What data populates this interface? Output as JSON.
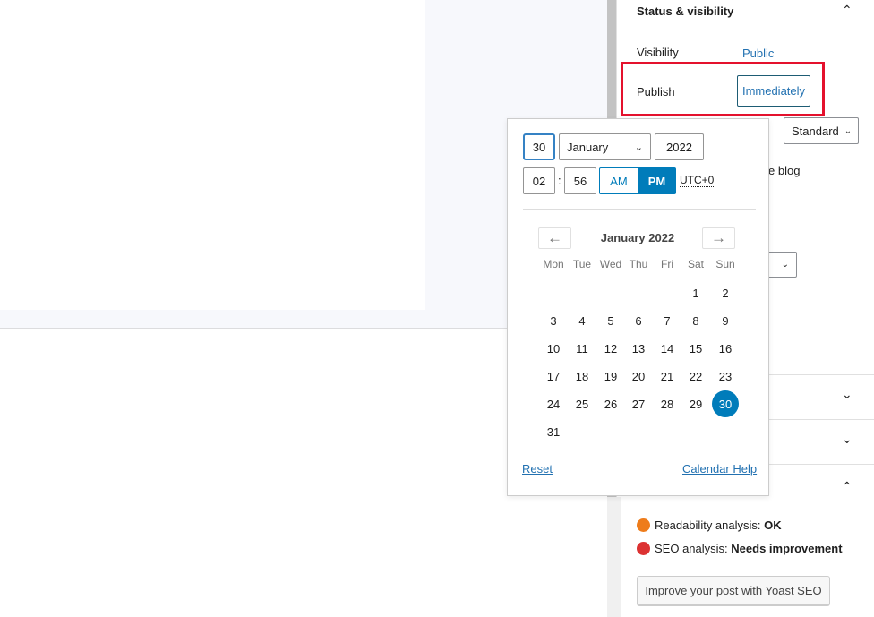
{
  "sidebar": {
    "panel_title": "Status & visibility",
    "visibility_label": "Visibility",
    "visibility_value": "Public",
    "publish_label": "Publish",
    "publish_value": "Immediately",
    "post_format_value": "Standard",
    "sticky_partial": "e blog",
    "yoast": {
      "readability_label": "Readability analysis:",
      "readability_value": "OK",
      "seo_label": "SEO analysis:",
      "seo_value": "Needs improvement",
      "button": "Improve your post with Yoast SEO",
      "readability_color": "#ee7c1b",
      "seo_color": "#dc3232"
    }
  },
  "datepicker": {
    "day": "30",
    "month": "January",
    "year": "2022",
    "hour": "02",
    "minute": "56",
    "am": "AM",
    "pm": "PM",
    "selected_period": "PM",
    "timezone": "UTC+0",
    "month_title": "January 2022",
    "weekdays": [
      "Mon",
      "Tue",
      "Wed",
      "Thu",
      "Fri",
      "Sat",
      "Sun"
    ],
    "weeks": [
      [
        "",
        "",
        "",
        "",
        "",
        "1",
        "2"
      ],
      [
        "3",
        "4",
        "5",
        "6",
        "7",
        "8",
        "9"
      ],
      [
        "10",
        "11",
        "12",
        "13",
        "14",
        "15",
        "16"
      ],
      [
        "17",
        "18",
        "19",
        "20",
        "21",
        "22",
        "23"
      ],
      [
        "24",
        "25",
        "26",
        "27",
        "28",
        "29",
        "30"
      ],
      [
        "31",
        "",
        "",
        "",
        "",
        "",
        ""
      ]
    ],
    "selected_day": "30",
    "reset": "Reset",
    "help": "Calendar Help",
    "accent": "#007cba"
  },
  "highlight_color": "#e4112d"
}
